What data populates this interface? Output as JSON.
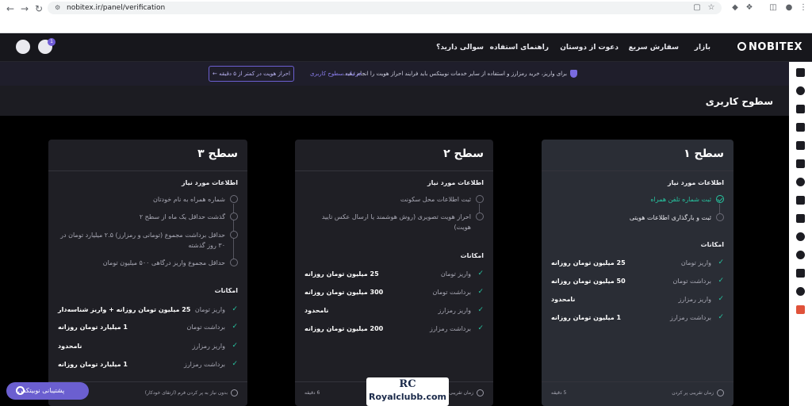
{
  "browser": {
    "url": "nobitex.ir/panel/verification"
  },
  "header": {
    "logo": "NOBITEX",
    "nav": [
      "بازار",
      "سفارش سریع",
      "دعوت از دوستان",
      "راهنمای استفاده",
      "سوالی دارید؟"
    ],
    "notifications_count": "1"
  },
  "announcement": {
    "text": "برای واریز، خرید رمزارز و استفاده از سایر خدمات نوبیتکس باید فرایند احراز هویت را انجام دهید.",
    "levels_link": "جزئیات سطوح کاربری",
    "verify_button": "احراز هویت در کمتر از ۵ دقیقه"
  },
  "page": {
    "title": "سطوح کاربری"
  },
  "cards": [
    {
      "title": "سطح ۱",
      "req_heading": "اطلاعات مورد نیاز",
      "requirements": [
        {
          "text": "ثبت شماره تلفن همراه"
        },
        {
          "text": "ثبت و بارگذاری اطلاعات هویتی"
        }
      ],
      "features_heading": "امکانات",
      "features": [
        {
          "label": "واریز تومان",
          "value": "25 میلیون تومان روزانه"
        },
        {
          "label": "برداشت تومان",
          "value": "50 میلیون تومان روزانه"
        },
        {
          "label": "واریز رمزارز",
          "value": "نامحدود"
        },
        {
          "label": "برداشت رمزارز",
          "value": "1 میلیون تومان روزانه"
        }
      ],
      "footer_label": "زمان تقریبی پر کردن",
      "footer_time": "5 دقیقه"
    },
    {
      "title": "سطح ۲",
      "req_heading": "اطلاعات مورد نیاز",
      "requirements": [
        {
          "text": "ثبت اطلاعات محل سکونت"
        },
        {
          "text": "احراز هویت تصویری (روش هوشمند یا ارسال عکس تایید هویت)"
        }
      ],
      "features_heading": "امکانات",
      "features": [
        {
          "label": "واریز تومان",
          "value": "25 میلیون تومان روزانه"
        },
        {
          "label": "برداشت تومان",
          "value": "300 میلیون تومان روزانه"
        },
        {
          "label": "واریز رمزارز",
          "value": "نامحدود"
        },
        {
          "label": "برداشت رمزارز",
          "value": "200 میلیون تومان روزانه"
        }
      ],
      "footer_label": "زمان تقریبی",
      "footer_time": "6 دقیقه"
    },
    {
      "title": "سطح ۳",
      "req_heading": "اطلاعات مورد نیاز",
      "requirements": [
        {
          "text": "شماره همراه به نام خودتان"
        },
        {
          "text": "گذشت حداقل یک ماه از سطح ۲"
        },
        {
          "text": "حداقل برداشت مجموع (تومانی و رمزارز) ۲.۵ میلیارد تومان در ۳۰ روز گذشته"
        },
        {
          "text": "حداقل مجموع واریز درگاهی ۵۰۰ میلیون تومان"
        }
      ],
      "features_heading": "امکانات",
      "features": [
        {
          "label": "واریز تومان",
          "value": "25 میلیون تومان روزانه + واریز شناسه‌دار"
        },
        {
          "label": "برداشت تومان",
          "value": "1 میلیارد تومان روزانه"
        },
        {
          "label": "واریز رمزارز",
          "value": "نامحدود"
        },
        {
          "label": "برداشت رمزارز",
          "value": "1 میلیارد تومان روزانه"
        }
      ],
      "footer_label": "بدون نیاز به پر کردن فرم (ارتقای خودکار)",
      "footer_time": ""
    }
  ],
  "support": {
    "label": "پشتیبانی نوبیتکس"
  },
  "watermark": {
    "logo": "RC",
    "name": "Royalclubb.com"
  }
}
